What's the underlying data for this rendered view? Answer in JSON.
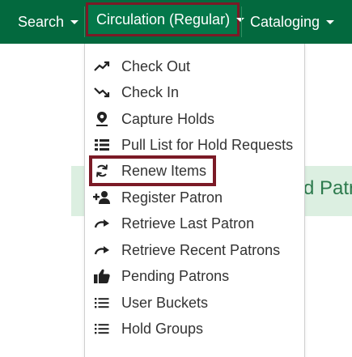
{
  "navbar": {
    "search_label": "Search",
    "circulation_label": "Circulation (Regular)",
    "cataloging_label": "Cataloging"
  },
  "background": {
    "banner_text": "d Patr"
  },
  "menu": {
    "items": [
      {
        "label": "Check Out",
        "icon": "trend-up-icon"
      },
      {
        "label": "Check In",
        "icon": "trend-down-icon"
      },
      {
        "label": "Capture Holds",
        "icon": "map-pin-icon"
      },
      {
        "label": "Pull List for Hold Requests",
        "icon": "list-icon"
      },
      {
        "label": "Renew Items",
        "icon": "refresh-icon"
      },
      {
        "label": "Register Patron",
        "icon": "add-user-icon"
      },
      {
        "label": "Retrieve Last Patron",
        "icon": "redo-arrow-icon"
      },
      {
        "label": "Retrieve Recent Patrons",
        "icon": "redo-arrow-icon"
      },
      {
        "label": "Pending Patrons",
        "icon": "thumbs-up-icon"
      },
      {
        "label": "User Buckets",
        "icon": "bulleted-list-icon"
      },
      {
        "label": "Hold Groups",
        "icon": "bulleted-list-icon"
      }
    ]
  },
  "colors": {
    "navbar": "#03693e",
    "highlight": "#7b1a26",
    "banner": "#dcefe1"
  }
}
